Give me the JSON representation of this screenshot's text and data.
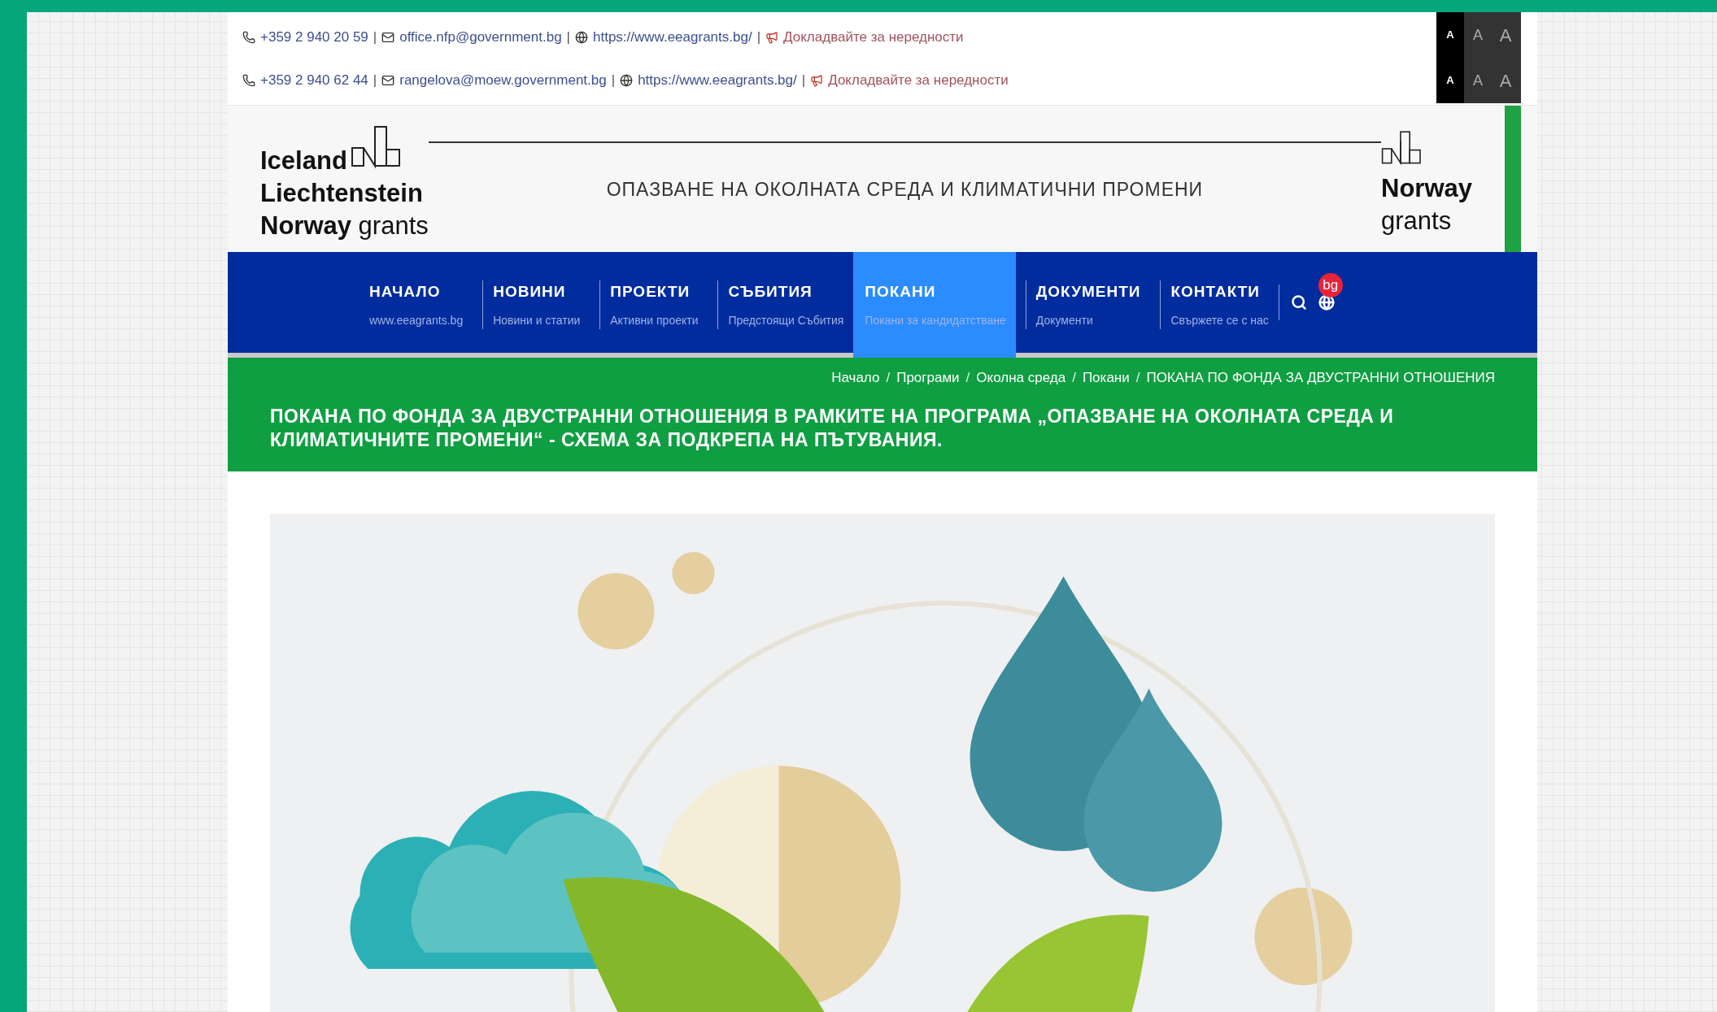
{
  "contact_separator": "|",
  "breadcrumb_separator": "/",
  "contact_rows": [
    {
      "phone": "+359 2 940 20 59",
      "email": "office.nfp@government.bg",
      "website": "https://www.eeagrants.bg/",
      "report_link": "Докладвайте за нередности"
    },
    {
      "phone": "+359 2 940 62 44",
      "email": "rangelova@moew.government.bg",
      "website": "https://www.eeagrants.bg/",
      "report_link": "Докладвайте за нередности"
    }
  ],
  "font_size_rows": [
    [
      {
        "label": "A",
        "selected": true
      },
      {
        "label": "A",
        "selected": false
      },
      {
        "label": "A",
        "selected": false
      }
    ],
    [
      {
        "label": "A",
        "selected": true
      },
      {
        "label": "A",
        "selected": false
      },
      {
        "label": "A",
        "selected": false
      }
    ]
  ],
  "header": {
    "logo_left": [
      "Iceland",
      "Liechtenstein",
      "Norway"
    ],
    "logo_left_suffix": "grants",
    "tagline": "ОПАЗВАНЕ НА ОКОЛНАТА СРЕДА И КЛИМАТИЧНИ ПРОМЕНИ",
    "logo_right": "Norway",
    "logo_right_suffix": "grants"
  },
  "nav": {
    "items": [
      {
        "label": "НАЧАЛО",
        "subtitle": "www.eeagrants.bg",
        "selected": false
      },
      {
        "label": "НОВИНИ",
        "subtitle": "Новини и статии",
        "selected": false
      },
      {
        "label": "ПРОЕКТИ",
        "subtitle": "Активни проекти",
        "selected": false
      },
      {
        "label": "СЪБИТИЯ",
        "subtitle": "Предстоящи Събития",
        "selected": false
      },
      {
        "label": "ПОКАНИ",
        "subtitle": "Покани за кандидатстване",
        "selected": true
      },
      {
        "label": "ДОКУМЕНТИ",
        "subtitle": "Документи",
        "selected": false
      },
      {
        "label": "КОНТАКТИ",
        "subtitle": "Свържете се с нас",
        "selected": false
      }
    ],
    "language_badge": "bg"
  },
  "breadcrumb": [
    "Начало",
    "Програми",
    "Околна среда",
    "Покани",
    "ПОКАНА ПО ФОНДА ЗА ДВУСТРАННИ ОТНОШЕНИЯ"
  ],
  "page_title": "ПОКАНА ПО ФОНДА ЗА ДВУСТРАННИ ОТНОШЕНИЯ В РАМКИТЕ НА ПРОГРАМА „ОПАЗВАНЕ НА ОКОЛНАТА СРЕДА И КЛИМАТИЧНИТЕ ПРОМЕНИ“ - СХЕМА ЗА ПОДКРЕПА НА ПЪТУВАНИЯ."
}
